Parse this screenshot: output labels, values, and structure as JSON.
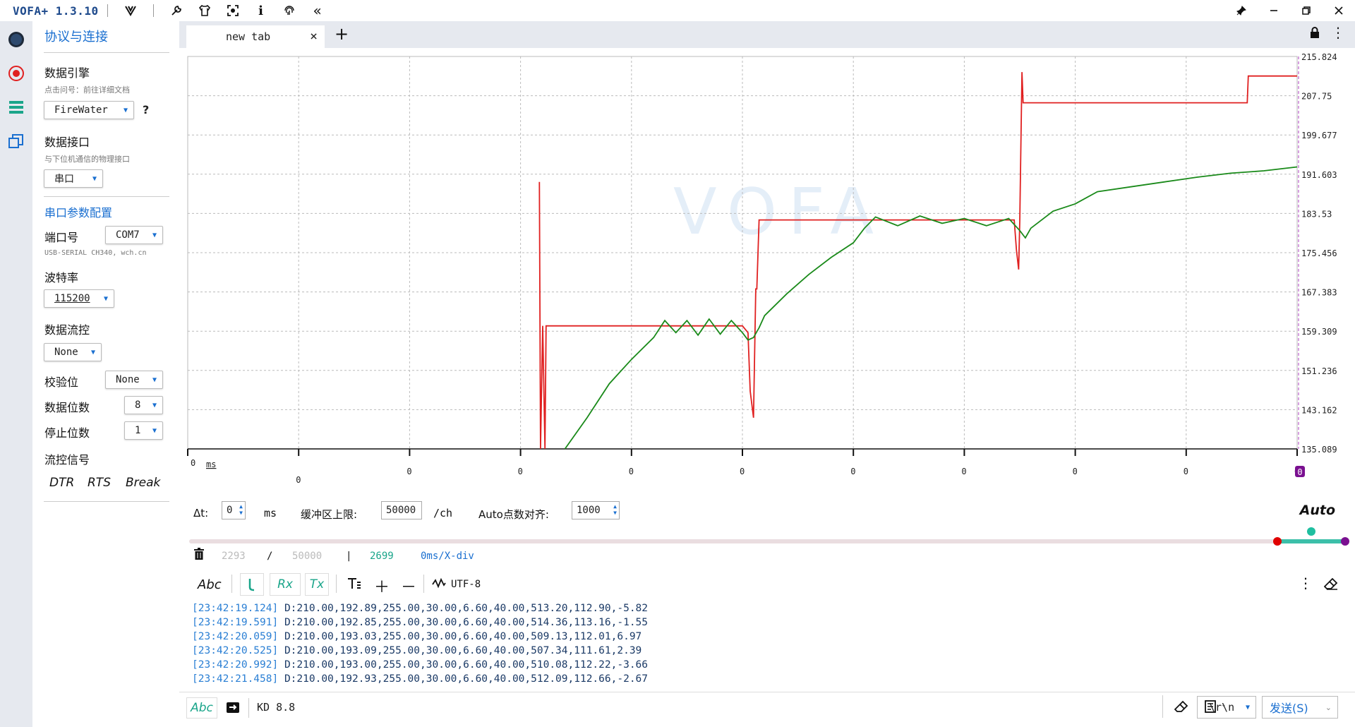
{
  "app": {
    "title": "VOFA+ 1.3.10"
  },
  "titlebar_icons": [
    "vofa-logo-icon",
    "wrench-icon",
    "shirt-icon",
    "screenshot-icon",
    "info-icon",
    "fingerprint-icon",
    "collapse-icon"
  ],
  "window_controls": [
    "pin-icon",
    "minimize-icon",
    "restore-icon",
    "close-icon"
  ],
  "rail": [
    "connection-icon",
    "record-icon",
    "list-icon",
    "windows-icon"
  ],
  "panel": {
    "title": "协议与连接",
    "engine": {
      "label": "数据引擎",
      "sub": "点击问号：前往详细文档",
      "value": "FireWater",
      "help": "?"
    },
    "interface": {
      "label": "数据接口",
      "sub": "与下位机通信的物理接口",
      "value": "串口"
    },
    "serial": {
      "title": "串口参数配置",
      "port_label": "端口号",
      "port_value": "COM7",
      "port_desc": "USB-SERIAL CH340, wch.cn",
      "baud_label": "波特率",
      "baud_value": "115200",
      "flow_label": "数据流控",
      "flow_value": "None",
      "parity_label": "校验位",
      "parity_value": "None",
      "databits_label": "数据位数",
      "databits_value": "8",
      "stopbits_label": "停止位数",
      "stopbits_value": "1",
      "signal_label": "流控信号",
      "dtr": "DTR",
      "rts": "RTS",
      "brk": "Break"
    }
  },
  "tab": {
    "name": "new tab",
    "close": "×",
    "add": "+"
  },
  "chart_data": {
    "type": "line",
    "y_ticks": [
      "215.824",
      "207.75",
      "199.677",
      "191.603",
      "183.53",
      "175.456",
      "167.383",
      "159.309",
      "151.236",
      "143.162",
      "135.089"
    ],
    "ylim": [
      135.089,
      215.824
    ],
    "x_unit": "ms",
    "x_first": "0",
    "x_ticks": [
      "0",
      "0",
      "0",
      "0",
      "0",
      "0",
      "0",
      "0",
      "0",
      "0"
    ],
    "cursor_badge": "0",
    "watermark": "VOFA",
    "grid": true,
    "series": [
      {
        "color": "#e02020",
        "x": [
          0,
          0.316,
          0.317,
          0.318,
          0.32,
          0.322,
          0.323,
          0.324,
          0.5,
          0.505,
          0.507,
          0.51,
          0.512,
          0.513,
          0.515,
          0.517,
          0.745,
          0.747,
          0.749,
          0.75,
          0.752,
          0.753,
          0.955,
          0.956,
          1.0
        ],
        "y": [
          null,
          null,
          190.0,
          135.089,
          160.4,
          135.089,
          160.4,
          160.4,
          160.4,
          159.0,
          147.0,
          141.5,
          168.0,
          168.0,
          182.2,
          182.2,
          182.2,
          176.0,
          172.0,
          182.0,
          212.6,
          206.3,
          206.3,
          211.8,
          211.8
        ]
      },
      {
        "color": "#1a8a1a",
        "x": [
          0.34,
          0.36,
          0.38,
          0.4,
          0.42,
          0.43,
          0.44,
          0.45,
          0.46,
          0.47,
          0.48,
          0.49,
          0.5,
          0.505,
          0.51,
          0.515,
          0.52,
          0.54,
          0.56,
          0.58,
          0.6,
          0.61,
          0.62,
          0.64,
          0.66,
          0.68,
          0.7,
          0.72,
          0.74,
          0.75,
          0.755,
          0.76,
          0.78,
          0.8,
          0.82,
          0.85,
          0.88,
          0.91,
          0.94,
          0.97,
          1.0
        ],
        "y": [
          135.089,
          141.5,
          148.5,
          153.5,
          158.0,
          161.5,
          159.0,
          161.5,
          158.5,
          161.8,
          158.7,
          161.5,
          159.0,
          157.5,
          158.0,
          160.0,
          162.5,
          167.0,
          171.0,
          174.5,
          177.5,
          180.5,
          182.8,
          181.0,
          183.0,
          181.5,
          182.5,
          181.0,
          182.5,
          180.0,
          178.5,
          180.5,
          184.0,
          185.5,
          188.0,
          189.0,
          190.0,
          191.0,
          191.8,
          192.3,
          193.1
        ]
      }
    ]
  },
  "controls": {
    "dt_label": "Δt:",
    "dt_value": "0",
    "dt_unit": "ms",
    "buffer_label": "缓冲区上限:",
    "buffer_value": "50000",
    "buffer_unit": "/ch",
    "align_label": "Auto点数对齐:",
    "align_value": "1000",
    "auto": "Auto"
  },
  "slider": {
    "green_start": 0.94
  },
  "stats": {
    "a": "2293",
    "sep1": "/",
    "b": "50000",
    "sep2": "|",
    "c": "2699",
    "d": "0ms/X-div"
  },
  "logbar": {
    "abc": "Abc",
    "rx": "Rx",
    "tx": "Tx",
    "encoding": "UTF-8"
  },
  "log": [
    {
      "ts": "[23:42:19.124]",
      "msg": " D:210.00,192.89,255.00,30.00,6.60,40.00,513.20,112.90,-5.82"
    },
    {
      "ts": "[23:42:19.591]",
      "msg": " D:210.00,192.85,255.00,30.00,6.60,40.00,514.36,113.16,-1.55"
    },
    {
      "ts": "[23:42:20.059]",
      "msg": " D:210.00,193.03,255.00,30.00,6.60,40.00,509.13,112.01,6.97"
    },
    {
      "ts": "[23:42:20.525]",
      "msg": " D:210.00,193.09,255.00,30.00,6.60,40.00,507.34,111.61,2.39"
    },
    {
      "ts": "[23:42:20.992]",
      "msg": " D:210.00,193.00,255.00,30.00,6.60,40.00,510.08,112.22,-3.66"
    },
    {
      "ts": "[23:42:21.458]",
      "msg": " D:210.00,192.93,255.00,30.00,6.60,40.00,512.09,112.66,-2.67"
    }
  ],
  "send": {
    "abc": "Abc",
    "input": "KD 8.8",
    "eol": "\\r\\n",
    "button": "发送(S)"
  }
}
